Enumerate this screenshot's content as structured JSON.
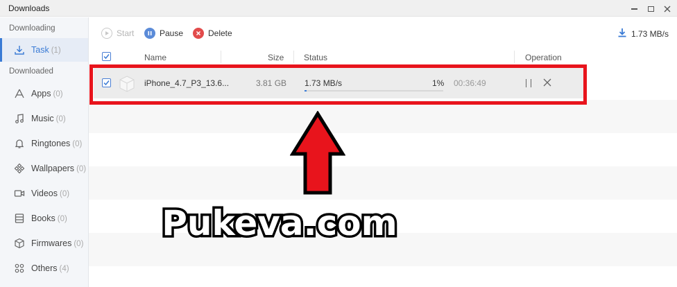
{
  "window": {
    "title": "Downloads"
  },
  "sidebar": {
    "downloading_label": "Downloading",
    "downloaded_label": "Downloaded",
    "items": [
      {
        "label": "Task",
        "count": "(1)",
        "icon": "download-tray-icon"
      },
      {
        "label": "Apps",
        "count": "(0)",
        "icon": "apps-icon"
      },
      {
        "label": "Music",
        "count": "(0)",
        "icon": "music-note-icon"
      },
      {
        "label": "Ringtones",
        "count": "(0)",
        "icon": "bell-icon"
      },
      {
        "label": "Wallpapers",
        "count": "(0)",
        "icon": "wallpaper-icon"
      },
      {
        "label": "Videos",
        "count": "(0)",
        "icon": "video-camera-icon"
      },
      {
        "label": "Books",
        "count": "(0)",
        "icon": "book-icon"
      },
      {
        "label": "Firmwares",
        "count": "(0)",
        "icon": "cube-icon"
      },
      {
        "label": "Others",
        "count": "(4)",
        "icon": "grid-icon"
      }
    ]
  },
  "toolbar": {
    "start_label": "Start",
    "pause_label": "Pause",
    "delete_label": "Delete",
    "total_speed": "1.73 MB/s"
  },
  "table": {
    "headers": {
      "name": "Name",
      "size": "Size",
      "status": "Status",
      "operation": "Operation"
    },
    "rows": [
      {
        "name": "iPhone_4.7_P3_13.6...",
        "size": "3.81 GB",
        "speed": "1.73 MB/s",
        "percent": "1%",
        "progress": 0.01,
        "time_left": "00:36:49"
      }
    ]
  },
  "overlay": {
    "watermark": "Pukeva.com",
    "highlight_color": "#e8141c"
  },
  "colors": {
    "accent": "#3a7bd5",
    "delete": "#e24b4b",
    "pause": "#5b8bd8"
  }
}
